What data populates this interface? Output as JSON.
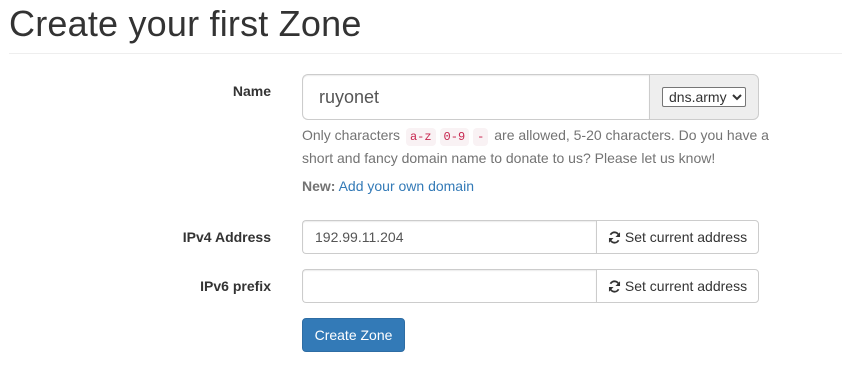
{
  "page": {
    "title": "Create your first Zone"
  },
  "form": {
    "name_label": "Name",
    "name_value": "ruyonet",
    "domain_options": [
      "dns.army"
    ],
    "domain_selected": "dns.army",
    "help_prefix": "Only characters",
    "help_code_1": "a-z",
    "help_code_2": "0-9",
    "help_code_3": "-",
    "help_suffix": "are allowed, 5-20 characters. Do you have a short and fancy domain name to donate to us? Please let us know!",
    "new_label": "New:",
    "new_link": "Add your own domain",
    "ipv4_label": "IPv4 Address",
    "ipv4_value": "192.99.11.204",
    "ipv6_label": "IPv6 prefix",
    "ipv6_value": "",
    "set_current_label": "Set current address",
    "submit_label": "Create Zone"
  },
  "icons": {
    "refresh": "refresh-icon"
  },
  "colors": {
    "primary": "#337ab7",
    "link": "#337ab7",
    "code_text": "#c7254e",
    "code_bg": "#f9f2f4",
    "addon_bg": "#eeeeee"
  }
}
